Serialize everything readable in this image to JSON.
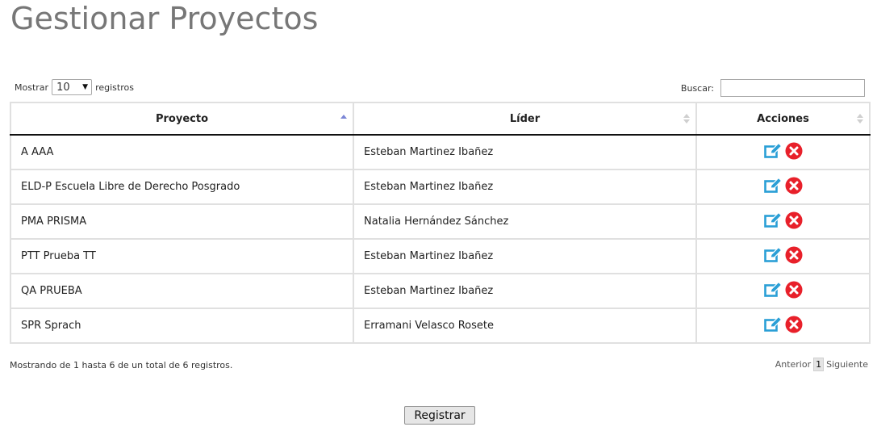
{
  "page": {
    "title": "Gestionar Proyectos"
  },
  "length_control": {
    "prefix": "Mostrar",
    "selected": "10",
    "suffix": "registros"
  },
  "search": {
    "label": "Buscar:",
    "value": ""
  },
  "table": {
    "columns": [
      "Proyecto",
      "Líder",
      "Acciones"
    ],
    "sort": {
      "column": "Proyecto",
      "direction": "ascending"
    },
    "rows": [
      {
        "proyecto": "A AAA",
        "lider": "Esteban Martinez Ibañez"
      },
      {
        "proyecto": "ELD-P Escuela Libre de Derecho Posgrado",
        "lider": "Esteban Martinez Ibañez"
      },
      {
        "proyecto": "PMA PRISMA",
        "lider": "Natalia Hernández Sánchez"
      },
      {
        "proyecto": "PTT Prueba TT",
        "lider": "Esteban Martinez Ibañez"
      },
      {
        "proyecto": "QA PRUEBA",
        "lider": "Esteban Martinez Ibañez"
      },
      {
        "proyecto": "SPR Sprach",
        "lider": "Erramani Velasco Rosete"
      }
    ],
    "row_actions": [
      "edit-icon",
      "delete-icon"
    ]
  },
  "info": "Mostrando de 1 hasta 6 de un total de 6 registros.",
  "pagination": {
    "previous": "Anterior",
    "current": "1",
    "next": "Siguiente"
  },
  "register_button": "Registrar",
  "colors": {
    "title": "#777777",
    "edit_icon": "#2a9fd6",
    "delete_icon": "#e8202a",
    "sort_active": "#7b86d6",
    "sort_inactive": "#cfcfcf"
  }
}
